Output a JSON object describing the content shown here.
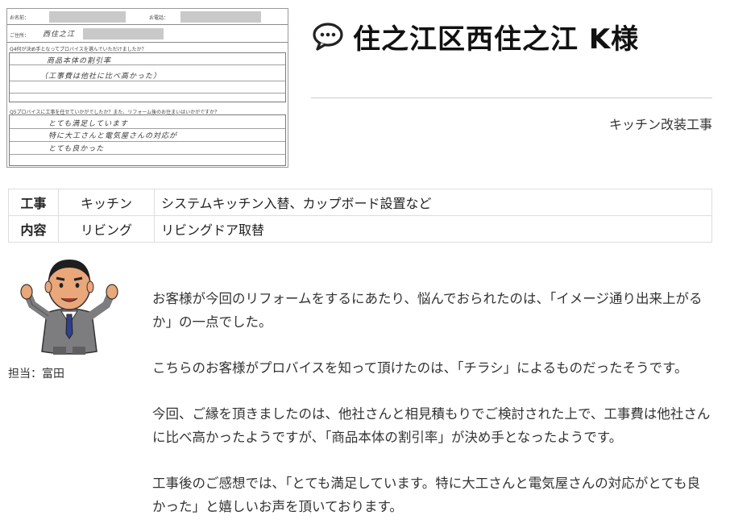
{
  "survey": {
    "name_label": "お名前：",
    "phone_label": "お電話：",
    "address_label": "ご住所：",
    "address_hand": "西住之江",
    "q4": "Q4何が決め手となってプロバイスを選んでいただけましたか？",
    "q4_answer_line1": "商品本体の割引率",
    "q4_answer_line2": "（工事費は他社に比べ高かった）",
    "q5": "Q5プロバイスに工事を任せていかがでしたか？また、リフォーム後のお住まいはいかがですか？",
    "q5_answer_line1": "とても満足しています",
    "q5_answer_line2": "特に大工さんと電気屋さんの対応が",
    "q5_answer_line3": "とても良かった"
  },
  "heading": {
    "icon": "speech-bubble-icon",
    "title": "住之江区西住之江 K様",
    "subtitle": "キッチン改装工事"
  },
  "work_table": {
    "rows": [
      {
        "label": "工事",
        "area": "キッチン",
        "detail": "システムキッチン入替、カップボード設置など"
      },
      {
        "label": "内容",
        "area": "リビング",
        "detail": "リビングドア取替"
      }
    ]
  },
  "staff": {
    "caption": "担当：富田"
  },
  "paragraphs": [
    "お客様が今回のリフォームをするにあたり、悩んでおられたのは、「イメージ通り出来上がるか」の一点でした。",
    "こちらのお客様がプロバイスを知って頂けたのは、「チラシ」によるものだったそうです。",
    "今回、ご縁を頂きましたのは、他社さんと相見積もりでご検討された上で、工事費は他社さんに比べ高かったようですが、「商品本体の割引率」が決め手となったようです。",
    "工事後のご感想では、「とても満足しています。特に大工さんと電気屋さんの対応がとても良かった」と嬉しいお声を頂いております。"
  ],
  "colors": {
    "text": "#333333",
    "border": "#dddddd",
    "suit": "#7d7d80",
    "skin": "#e9a77a"
  }
}
